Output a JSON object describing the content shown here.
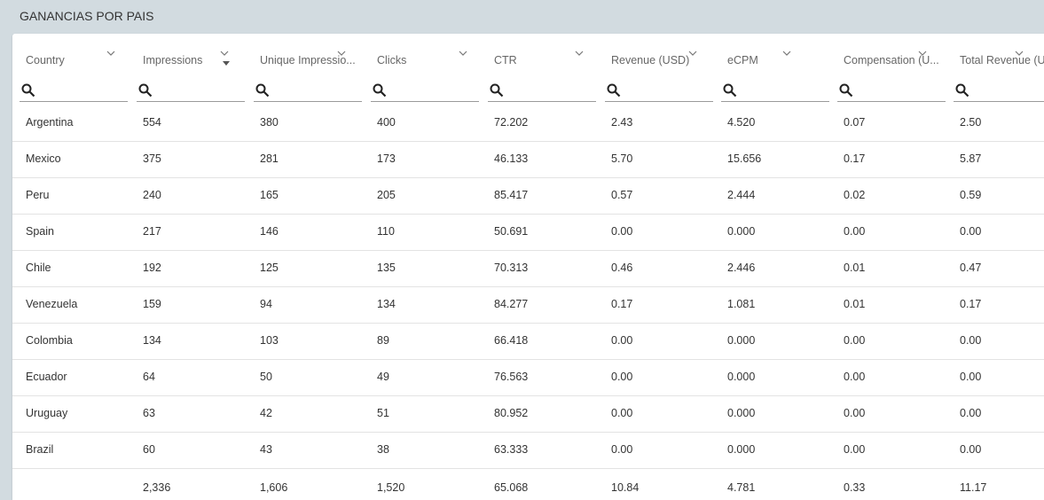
{
  "panel": {
    "title": "GANANCIAS POR PAIS"
  },
  "columns": [
    {
      "key": "country",
      "label": "Country"
    },
    {
      "key": "impressions",
      "label": "Impressions"
    },
    {
      "key": "unique",
      "label": "Unique Impressio..."
    },
    {
      "key": "clicks",
      "label": "Clicks"
    },
    {
      "key": "ctr",
      "label": "CTR"
    },
    {
      "key": "revenue",
      "label": "Revenue (USD)"
    },
    {
      "key": "ecpm",
      "label": "eCPM"
    },
    {
      "key": "compensation",
      "label": "Compensation (U..."
    },
    {
      "key": "total_revenue",
      "label": "Total Revenue (U"
    }
  ],
  "filters": {
    "placeholder": ""
  },
  "rows": [
    [
      "Argentina",
      "554",
      "380",
      "400",
      "72.202",
      "2.43",
      "4.520",
      "0.07",
      "2.50"
    ],
    [
      "Mexico",
      "375",
      "281",
      "173",
      "46.133",
      "5.70",
      "15.656",
      "0.17",
      "5.87"
    ],
    [
      "Peru",
      "240",
      "165",
      "205",
      "85.417",
      "0.57",
      "2.444",
      "0.02",
      "0.59"
    ],
    [
      "Spain",
      "217",
      "146",
      "110",
      "50.691",
      "0.00",
      "0.000",
      "0.00",
      "0.00"
    ],
    [
      "Chile",
      "192",
      "125",
      "135",
      "70.313",
      "0.46",
      "2.446",
      "0.01",
      "0.47"
    ],
    [
      "Venezuela",
      "159",
      "94",
      "134",
      "84.277",
      "0.17",
      "1.081",
      "0.01",
      "0.17"
    ],
    [
      "Colombia",
      "134",
      "103",
      "89",
      "66.418",
      "0.00",
      "0.000",
      "0.00",
      "0.00"
    ],
    [
      "Ecuador",
      "64",
      "50",
      "49",
      "76.563",
      "0.00",
      "0.000",
      "0.00",
      "0.00"
    ],
    [
      "Uruguay",
      "63",
      "42",
      "51",
      "80.952",
      "0.00",
      "0.000",
      "0.00",
      "0.00"
    ],
    [
      "Brazil",
      "60",
      "43",
      "38",
      "63.333",
      "0.00",
      "0.000",
      "0.00",
      "0.00"
    ]
  ],
  "totals": [
    "",
    "2,336",
    "1,606",
    "1,520",
    "65.068",
    "10.84",
    "4.781",
    "0.33",
    "11.17"
  ],
  "icons": {
    "filter": "search-icon",
    "column_menu": "chevron-down-icon",
    "sort": "sort-desc-icon"
  },
  "sorted_column": "impressions"
}
